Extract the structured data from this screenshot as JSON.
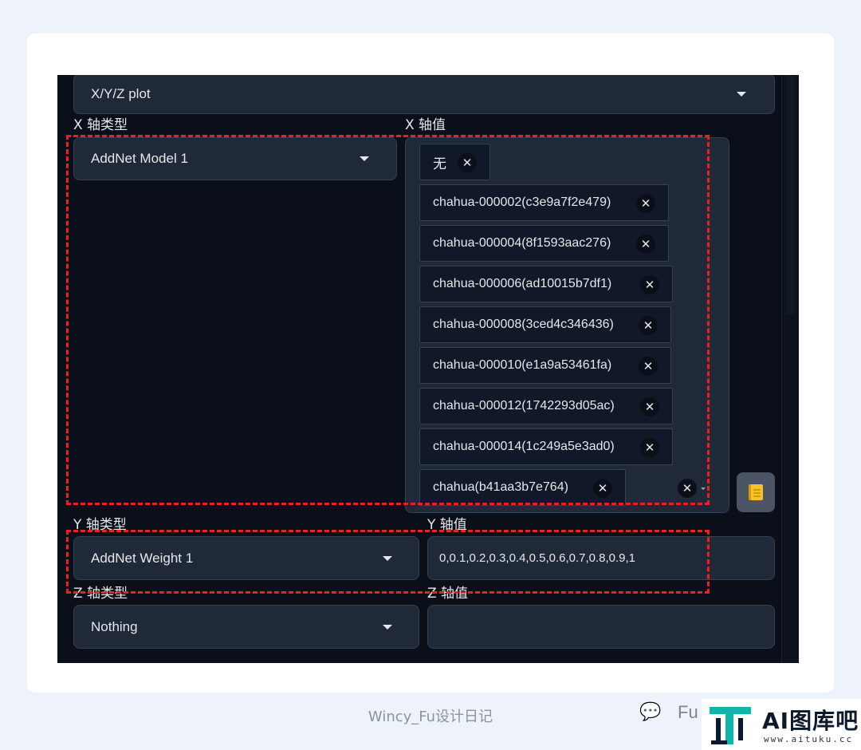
{
  "script_select": {
    "value": "X/Y/Z plot"
  },
  "x_axis": {
    "type_label": "X 轴类型",
    "type_value": "AddNet Model 1",
    "values_label": "X 轴值",
    "chips": [
      "无",
      "chahua-000002(c3e9a7f2e479)",
      "chahua-000004(8f1593aac276)",
      "chahua-000006(ad10015b7df1)",
      "chahua-000008(3ced4c346436)",
      "chahua-000010(e1a9a53461fa)",
      "chahua-000012(1742293d05ac)",
      "chahua-000014(1c249a5e3ad0)",
      "chahua(b41aa3b7e764)"
    ],
    "remove_glyph": "✕"
  },
  "y_axis": {
    "type_label": "Y 轴类型",
    "type_value": "AddNet Weight 1",
    "values_label": "Y 轴值",
    "values": "0,0.1,0.2,0.3,0.4,0.5,0.6,0.7,0.8,0.9,1"
  },
  "z_axis": {
    "type_label": "Z 轴类型",
    "type_value": "Nothing",
    "values_label": "Z 轴值",
    "values": ""
  },
  "footer": {
    "author": "Wincy_Fu设计日记",
    "wechat_name": "Fu"
  },
  "logo": {
    "main": "AI图库吧",
    "sub": "www.aituku.cc"
  },
  "colors": {
    "panel_bg": "#0b0f19",
    "input_bg": "#1f2937",
    "highlight": "#ef1f1f"
  }
}
